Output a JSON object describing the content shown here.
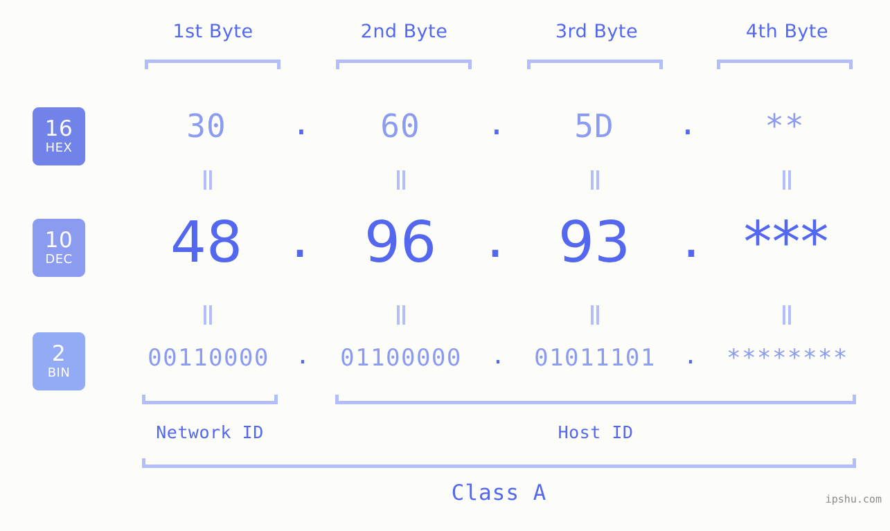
{
  "meta": {
    "background_color": "#fcfdf8",
    "accent_strong": "#5468ef",
    "accent_light": "#8b9bf0",
    "accent_pale": "#b3bdfa"
  },
  "headers": [
    {
      "label": "1st Byte"
    },
    {
      "label": "2nd Byte"
    },
    {
      "label": "3rd Byte"
    },
    {
      "label": "4th Byte"
    }
  ],
  "rows": [
    {
      "base": "16",
      "base_name": "HEX",
      "badge_color": "#7183e8",
      "values": [
        "30",
        "60",
        "5D",
        "**"
      ],
      "separator": "."
    },
    {
      "base": "10",
      "base_name": "DEC",
      "badge_color": "#8b9bf0",
      "values": [
        "48",
        "96",
        "93",
        "***"
      ],
      "separator": "."
    },
    {
      "base": "2",
      "base_name": "BIN",
      "badge_color": "#93aaf5",
      "values": [
        "00110000",
        "01100000",
        "01011101",
        "********"
      ],
      "separator": "."
    }
  ],
  "equals_marks": {
    "glyph": "||",
    "count_per_row": 4
  },
  "segments": {
    "network_id": "Network ID",
    "host_id": "Host ID",
    "class": "Class A"
  },
  "watermark": "ipshu.com"
}
